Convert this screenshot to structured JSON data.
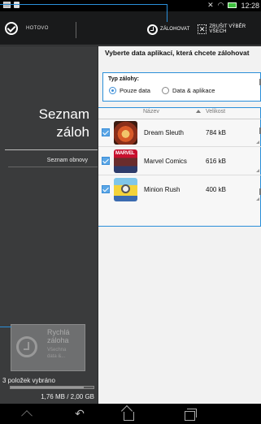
{
  "status_bar": {
    "time": "12:28",
    "icons": [
      "notification-icon",
      "document-icon",
      "silent-icon",
      "wifi-icon",
      "battery-icon"
    ]
  },
  "action_bar": {
    "done_label": "HOTOVO",
    "backup_label": "ZÁLOHOVAT",
    "cancel_selection_label": "ZRUŠIT VÝBĚR VŠECH",
    "icons": [
      "check-circle-icon",
      "backup-icon",
      "deselect-icon"
    ]
  },
  "sidebar": {
    "title_line1": "Seznam",
    "title_line2": "záloh",
    "restore_list_label": "Seznam obnovy",
    "quick_backup": {
      "title_line1": "Rychlá",
      "title_line2": "záloha",
      "subtitle_line1": "Všechna",
      "subtitle_line2": "data &..."
    },
    "selected_count": "3 položek vybráno",
    "storage_text": "1,76 MB / 2,00 GB",
    "storage_fraction": 0.88
  },
  "main": {
    "heading": "Vyberte data aplikací, která chcete zálohovat",
    "backup_type": {
      "label": "Typ zálohy:",
      "options": [
        "Pouze data",
        "Data & aplikace"
      ],
      "selected": "Pouze data"
    },
    "table": {
      "columns": [
        "Název",
        "Velikost"
      ],
      "rows": [
        {
          "name": "Dream Sleuth",
          "size": "784 kB",
          "checked": true,
          "icon": "dream-sleuth-icon"
        },
        {
          "name": "Marvel Comics",
          "size": "616 kB",
          "checked": true,
          "icon": "marvel-comics-icon",
          "icon_text": "MARVEL"
        },
        {
          "name": "Minion Rush",
          "size": "400 kB",
          "checked": true,
          "icon": "minion-rush-icon"
        }
      ]
    }
  },
  "nav_bar": {
    "icons": [
      "up-icon",
      "back-icon",
      "home-icon",
      "recent-apps-icon"
    ]
  },
  "colors": {
    "accent": "#2a8fd9",
    "sidebar_bg": "#3a3b3c",
    "action_bar_bg": "#191a1b",
    "panel_bg": "#f2f2f2"
  }
}
